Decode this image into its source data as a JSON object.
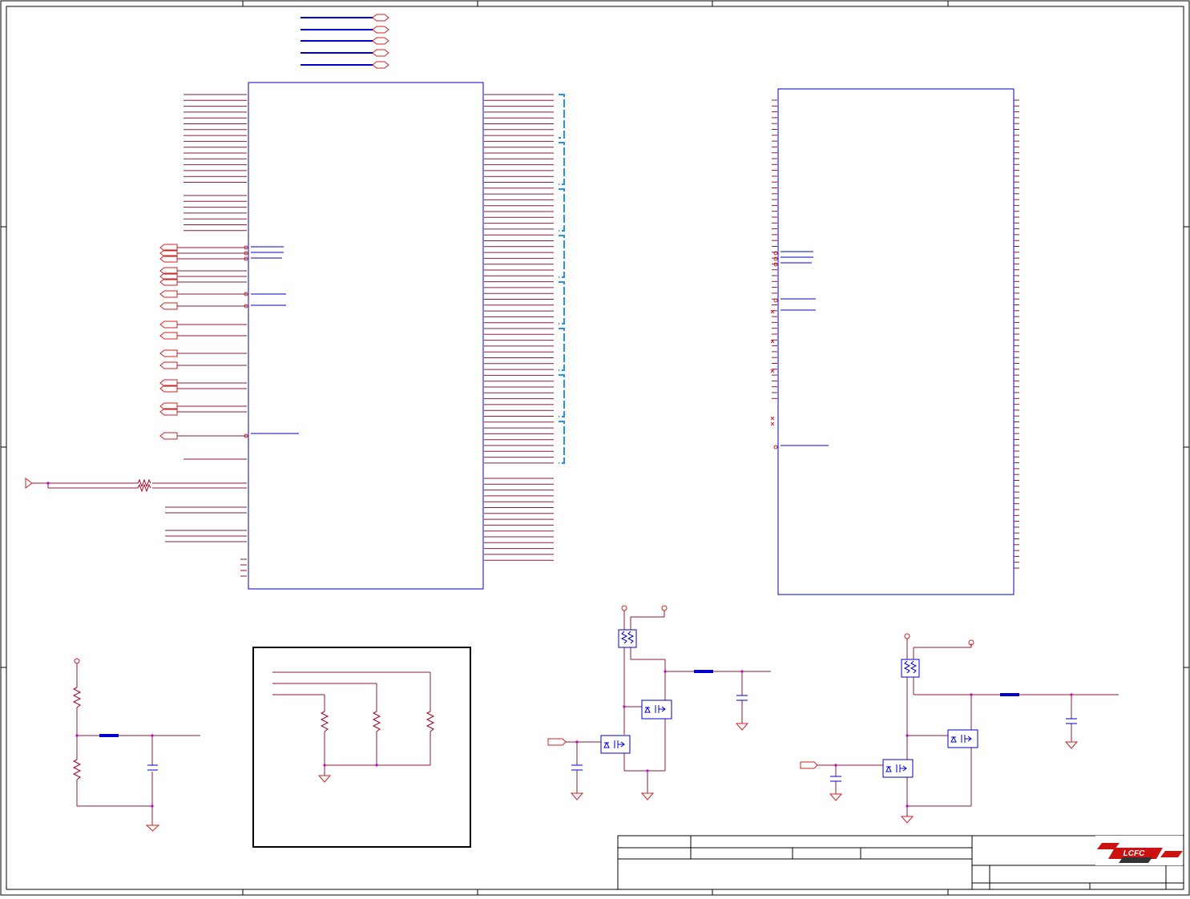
{
  "sheet": {
    "colors": {
      "frame": "#000000",
      "wire": "#8b1a3a",
      "net_label": "#cc2222",
      "symbol": "#0000cc",
      "bus_bracket": "#1e90ff",
      "junction": "#cc00cc",
      "component": "#a0001a"
    },
    "title_block": {
      "logo": "LCFC"
    }
  }
}
